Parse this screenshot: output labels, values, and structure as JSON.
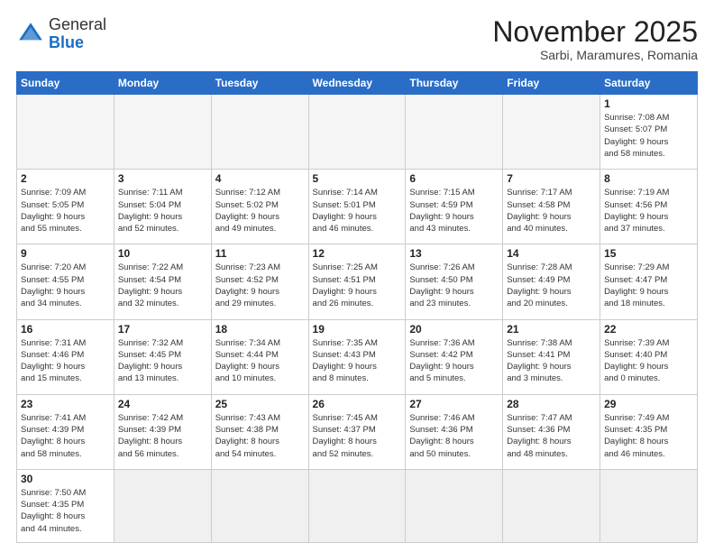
{
  "header": {
    "logo_general": "General",
    "logo_blue": "Blue",
    "month": "November 2025",
    "location": "Sarbi, Maramures, Romania"
  },
  "weekdays": [
    "Sunday",
    "Monday",
    "Tuesday",
    "Wednesday",
    "Thursday",
    "Friday",
    "Saturday"
  ],
  "weeks": [
    [
      {
        "day": "",
        "info": ""
      },
      {
        "day": "",
        "info": ""
      },
      {
        "day": "",
        "info": ""
      },
      {
        "day": "",
        "info": ""
      },
      {
        "day": "",
        "info": ""
      },
      {
        "day": "",
        "info": ""
      },
      {
        "day": "1",
        "info": "Sunrise: 7:08 AM\nSunset: 5:07 PM\nDaylight: 9 hours\nand 58 minutes."
      }
    ],
    [
      {
        "day": "2",
        "info": "Sunrise: 7:09 AM\nSunset: 5:05 PM\nDaylight: 9 hours\nand 55 minutes."
      },
      {
        "day": "3",
        "info": "Sunrise: 7:11 AM\nSunset: 5:04 PM\nDaylight: 9 hours\nand 52 minutes."
      },
      {
        "day": "4",
        "info": "Sunrise: 7:12 AM\nSunset: 5:02 PM\nDaylight: 9 hours\nand 49 minutes."
      },
      {
        "day": "5",
        "info": "Sunrise: 7:14 AM\nSunset: 5:01 PM\nDaylight: 9 hours\nand 46 minutes."
      },
      {
        "day": "6",
        "info": "Sunrise: 7:15 AM\nSunset: 4:59 PM\nDaylight: 9 hours\nand 43 minutes."
      },
      {
        "day": "7",
        "info": "Sunrise: 7:17 AM\nSunset: 4:58 PM\nDaylight: 9 hours\nand 40 minutes."
      },
      {
        "day": "8",
        "info": "Sunrise: 7:19 AM\nSunset: 4:56 PM\nDaylight: 9 hours\nand 37 minutes."
      }
    ],
    [
      {
        "day": "9",
        "info": "Sunrise: 7:20 AM\nSunset: 4:55 PM\nDaylight: 9 hours\nand 34 minutes."
      },
      {
        "day": "10",
        "info": "Sunrise: 7:22 AM\nSunset: 4:54 PM\nDaylight: 9 hours\nand 32 minutes."
      },
      {
        "day": "11",
        "info": "Sunrise: 7:23 AM\nSunset: 4:52 PM\nDaylight: 9 hours\nand 29 minutes."
      },
      {
        "day": "12",
        "info": "Sunrise: 7:25 AM\nSunset: 4:51 PM\nDaylight: 9 hours\nand 26 minutes."
      },
      {
        "day": "13",
        "info": "Sunrise: 7:26 AM\nSunset: 4:50 PM\nDaylight: 9 hours\nand 23 minutes."
      },
      {
        "day": "14",
        "info": "Sunrise: 7:28 AM\nSunset: 4:49 PM\nDaylight: 9 hours\nand 20 minutes."
      },
      {
        "day": "15",
        "info": "Sunrise: 7:29 AM\nSunset: 4:47 PM\nDaylight: 9 hours\nand 18 minutes."
      }
    ],
    [
      {
        "day": "16",
        "info": "Sunrise: 7:31 AM\nSunset: 4:46 PM\nDaylight: 9 hours\nand 15 minutes."
      },
      {
        "day": "17",
        "info": "Sunrise: 7:32 AM\nSunset: 4:45 PM\nDaylight: 9 hours\nand 13 minutes."
      },
      {
        "day": "18",
        "info": "Sunrise: 7:34 AM\nSunset: 4:44 PM\nDaylight: 9 hours\nand 10 minutes."
      },
      {
        "day": "19",
        "info": "Sunrise: 7:35 AM\nSunset: 4:43 PM\nDaylight: 9 hours\nand 8 minutes."
      },
      {
        "day": "20",
        "info": "Sunrise: 7:36 AM\nSunset: 4:42 PM\nDaylight: 9 hours\nand 5 minutes."
      },
      {
        "day": "21",
        "info": "Sunrise: 7:38 AM\nSunset: 4:41 PM\nDaylight: 9 hours\nand 3 minutes."
      },
      {
        "day": "22",
        "info": "Sunrise: 7:39 AM\nSunset: 4:40 PM\nDaylight: 9 hours\nand 0 minutes."
      }
    ],
    [
      {
        "day": "23",
        "info": "Sunrise: 7:41 AM\nSunset: 4:39 PM\nDaylight: 8 hours\nand 58 minutes."
      },
      {
        "day": "24",
        "info": "Sunrise: 7:42 AM\nSunset: 4:39 PM\nDaylight: 8 hours\nand 56 minutes."
      },
      {
        "day": "25",
        "info": "Sunrise: 7:43 AM\nSunset: 4:38 PM\nDaylight: 8 hours\nand 54 minutes."
      },
      {
        "day": "26",
        "info": "Sunrise: 7:45 AM\nSunset: 4:37 PM\nDaylight: 8 hours\nand 52 minutes."
      },
      {
        "day": "27",
        "info": "Sunrise: 7:46 AM\nSunset: 4:36 PM\nDaylight: 8 hours\nand 50 minutes."
      },
      {
        "day": "28",
        "info": "Sunrise: 7:47 AM\nSunset: 4:36 PM\nDaylight: 8 hours\nand 48 minutes."
      },
      {
        "day": "29",
        "info": "Sunrise: 7:49 AM\nSunset: 4:35 PM\nDaylight: 8 hours\nand 46 minutes."
      }
    ],
    [
      {
        "day": "30",
        "info": "Sunrise: 7:50 AM\nSunset: 4:35 PM\nDaylight: 8 hours\nand 44 minutes."
      },
      {
        "day": "",
        "info": ""
      },
      {
        "day": "",
        "info": ""
      },
      {
        "day": "",
        "info": ""
      },
      {
        "day": "",
        "info": ""
      },
      {
        "day": "",
        "info": ""
      },
      {
        "day": "",
        "info": ""
      }
    ]
  ]
}
